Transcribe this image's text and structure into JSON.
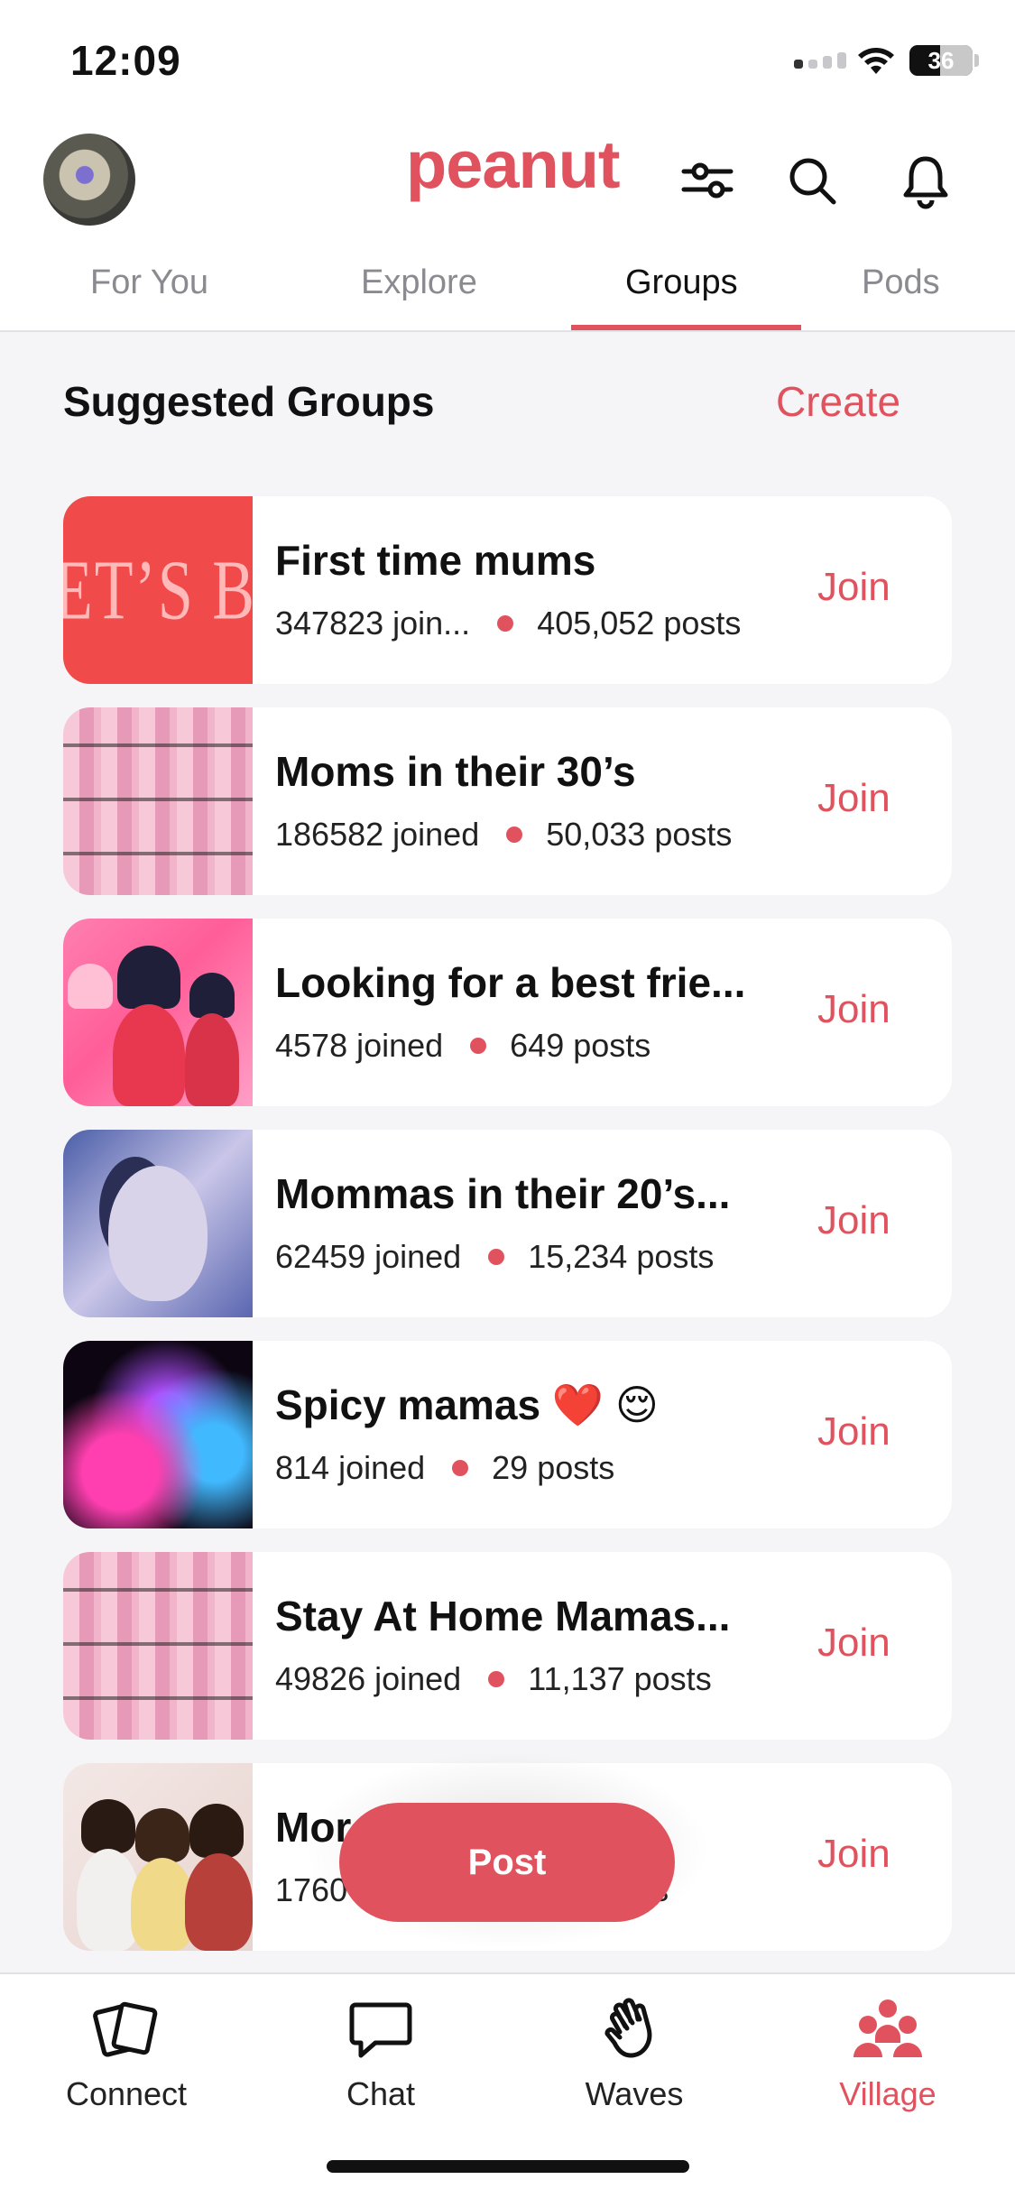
{
  "status_bar": {
    "time": "12:09",
    "battery": "36"
  },
  "header": {
    "logo": "peanut",
    "icons": [
      "filter-icon",
      "search-icon",
      "bell-icon"
    ]
  },
  "tabs": [
    {
      "label": "For You",
      "active": false
    },
    {
      "label": "Explore",
      "active": false
    },
    {
      "label": "Groups",
      "active": true
    },
    {
      "label": "Pods",
      "active": false
    }
  ],
  "section": {
    "title": "Suggested Groups",
    "action": "Create"
  },
  "groups": [
    {
      "name": "First time mums",
      "joined": "347823 join...",
      "posts": "405,052 posts",
      "action": "Join"
    },
    {
      "name": "Moms in their 30’s",
      "joined": "186582 joined",
      "posts": "50,033 posts",
      "action": "Join"
    },
    {
      "name": "Looking for a best frie...",
      "joined": "4578 joined",
      "posts": "649 posts",
      "action": "Join"
    },
    {
      "name": "Mommas in their 20’s...",
      "joined": "62459 joined",
      "posts": "15,234 posts",
      "action": "Join"
    },
    {
      "name": "Spicy mamas ❤️ 😌",
      "joined": "814 joined",
      "posts": "29 posts",
      "action": "Join"
    },
    {
      "name": "Stay At Home Mamas...",
      "joined": "49826 joined",
      "posts": "11,137 posts",
      "action": "Join"
    },
    {
      "name": "Mor                frie...",
      "joined": "1760",
      "posts": "posts",
      "action": "Join"
    }
  ],
  "thumb_text": "ET’S BE TH",
  "post_button": "Post",
  "bottom_nav": [
    {
      "label": "Connect",
      "icon": "cards-icon",
      "active": false
    },
    {
      "label": "Chat",
      "icon": "chat-bubble-icon",
      "active": false
    },
    {
      "label": "Waves",
      "icon": "waving-hand-icon",
      "active": false
    },
    {
      "label": "Village",
      "icon": "people-group-icon",
      "active": true
    }
  ],
  "colors": {
    "accent": "#e0535e",
    "background": "#f5f5f7",
    "card": "#ffffff"
  }
}
